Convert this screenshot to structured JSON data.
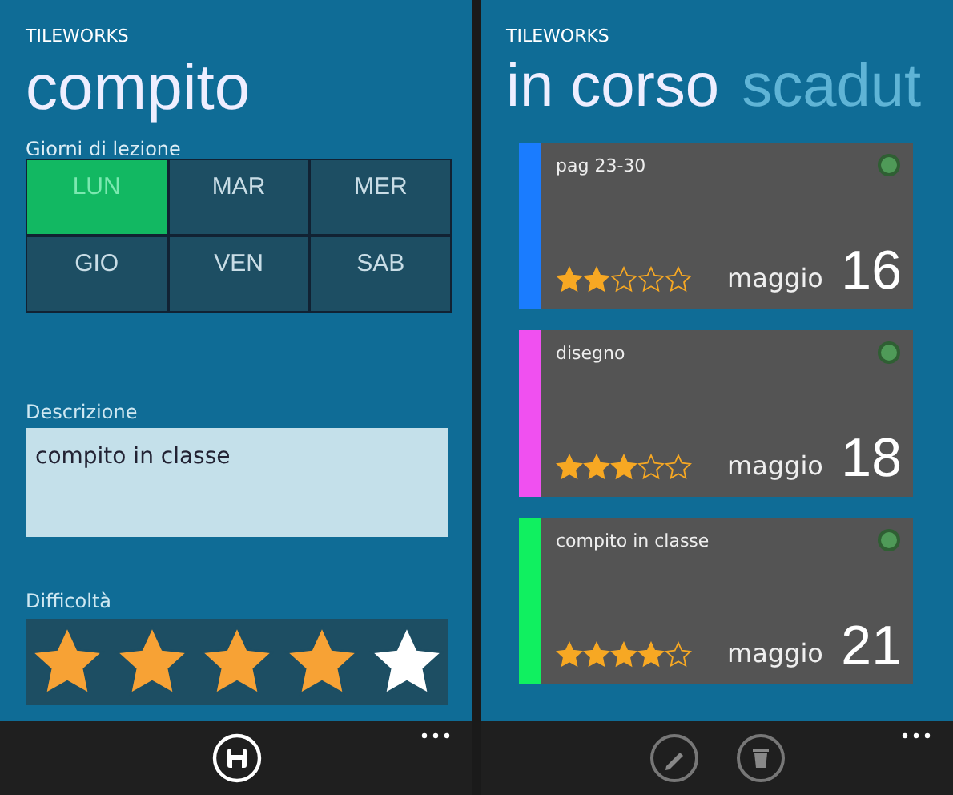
{
  "left": {
    "app_name": "TILEWORKS",
    "title": "compito",
    "days_label": "Giorni di lezione",
    "days": [
      {
        "label": "LUN",
        "selected": true
      },
      {
        "label": "MAR",
        "selected": false
      },
      {
        "label": "MER",
        "selected": false
      },
      {
        "label": "GIO",
        "selected": false
      },
      {
        "label": "VEN",
        "selected": false
      },
      {
        "label": "SAB",
        "selected": false
      }
    ],
    "description_label": "Descrizione",
    "description": {
      "value": "compito in classe"
    },
    "difficulty_label": "Difficoltà",
    "difficulty": {
      "stars": 4
    }
  },
  "right": {
    "app_name": "TILEWORKS",
    "pivots": [
      {
        "label": "in corso",
        "selected": true
      },
      {
        "label": "scadut",
        "selected": false
      }
    ],
    "tasks": [
      {
        "title": "pag 23-30",
        "color": "#1a7cff",
        "stars": 2,
        "month": "maggio",
        "day": "16"
      },
      {
        "title": "disegno",
        "color": "#f050f0",
        "stars": 3,
        "month": "maggio",
        "day": "18"
      },
      {
        "title": "compito in classe",
        "color": "#10f060",
        "stars": 4,
        "month": "maggio",
        "day": "21"
      }
    ]
  }
}
